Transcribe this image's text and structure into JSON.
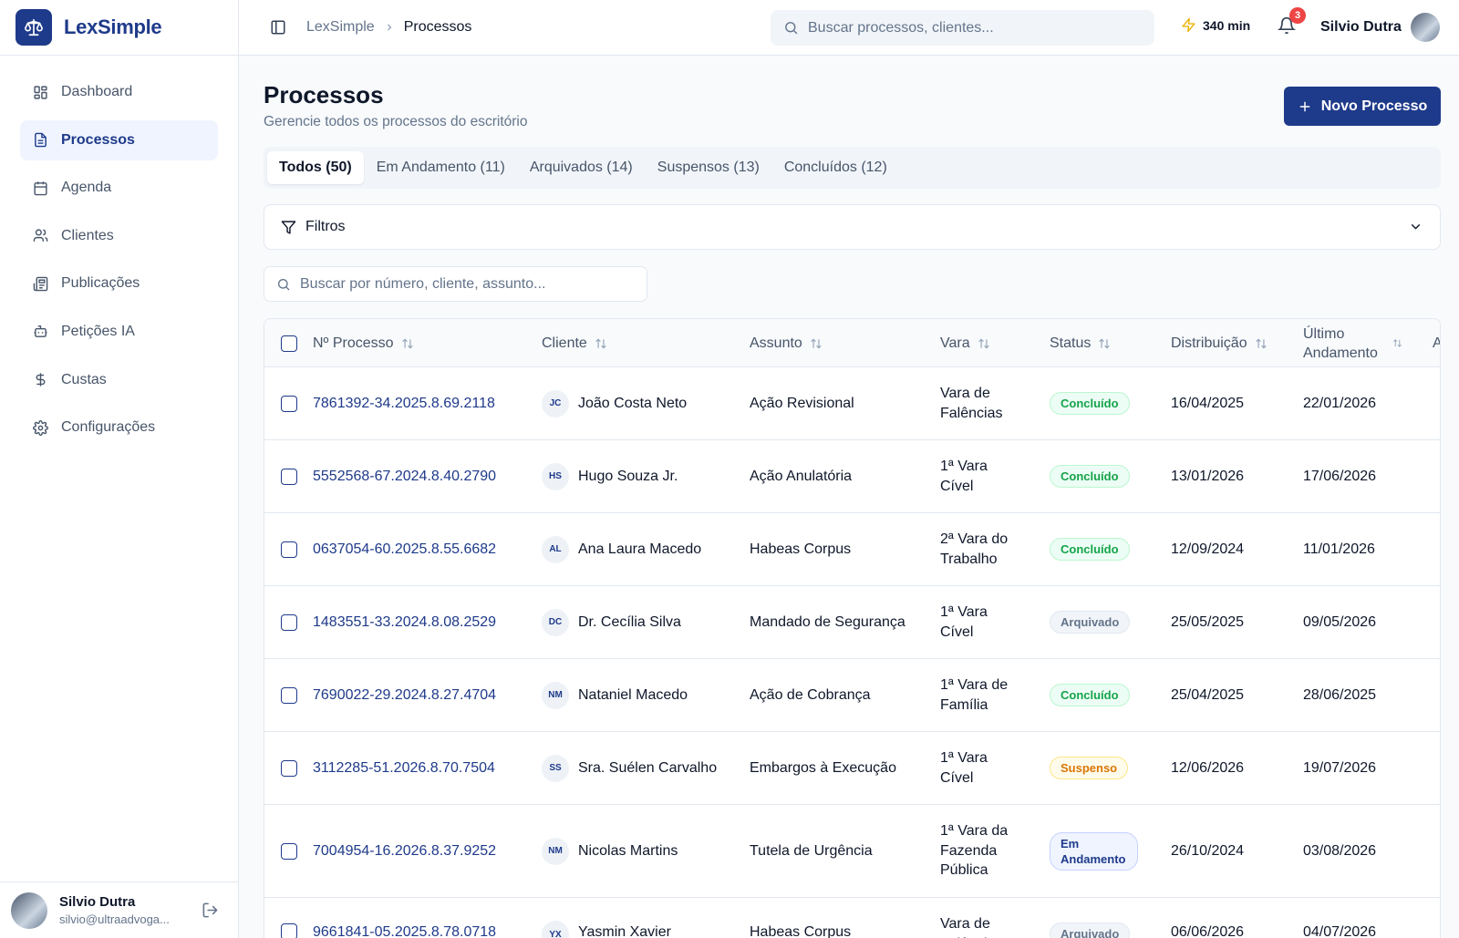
{
  "app": {
    "name": "LexSimple"
  },
  "sidebar": {
    "items": [
      {
        "label": "Dashboard",
        "icon": "dashboard-icon"
      },
      {
        "label": "Processos",
        "icon": "document-icon",
        "active": true
      },
      {
        "label": "Agenda",
        "icon": "calendar-icon"
      },
      {
        "label": "Clientes",
        "icon": "users-icon"
      },
      {
        "label": "Publicações",
        "icon": "newspaper-icon"
      },
      {
        "label": "Petições IA",
        "icon": "robot-icon"
      },
      {
        "label": "Custas",
        "icon": "dollar-icon"
      },
      {
        "label": "Configurações",
        "icon": "gear-icon"
      }
    ],
    "user": {
      "name": "Silvio Dutra",
      "email": "silvio@ultraadvoga..."
    }
  },
  "header": {
    "breadcrumb": [
      "LexSimple",
      "Processos"
    ],
    "search_placeholder": "Buscar processos, clientes...",
    "credits": "340 min",
    "notifications": "3",
    "user_name": "Silvio Dutra"
  },
  "page": {
    "title": "Processos",
    "subtitle": "Gerencie todos os processos do escritório",
    "new_button": "Novo Processo",
    "tabs": [
      "Todos (50)",
      "Em Andamento (11)",
      "Arquivados (14)",
      "Suspensos (13)",
      "Concluídos (12)"
    ],
    "filters_label": "Filtros",
    "table_search_placeholder": "Buscar por número, cliente, assunto..."
  },
  "table": {
    "columns": [
      "Nº Processo",
      "Cliente",
      "Assunto",
      "Vara",
      "Status",
      "Distribuição",
      "Último Andamento",
      "A"
    ],
    "rows": [
      {
        "num": "7861392-34.2025.8.69.2118",
        "ini": "JC",
        "client": "João Costa Neto",
        "subject": "Ação Revisional",
        "vara": "Vara de Falências",
        "status": "Concluído",
        "status_key": "concluido",
        "dist": "16/04/2025",
        "last": "22/01/2026"
      },
      {
        "num": "5552568-67.2024.8.40.2790",
        "ini": "HS",
        "client": "Hugo Souza Jr.",
        "subject": "Ação Anulatória",
        "vara": "1ª Vara Cível",
        "status": "Concluído",
        "status_key": "concluido",
        "dist": "13/01/2026",
        "last": "17/06/2026"
      },
      {
        "num": "0637054-60.2025.8.55.6682",
        "ini": "AL",
        "client": "Ana Laura Macedo",
        "subject": "Habeas Corpus",
        "vara": "2ª Vara do Trabalho",
        "status": "Concluído",
        "status_key": "concluido",
        "dist": "12/09/2024",
        "last": "11/01/2026"
      },
      {
        "num": "1483551-33.2024.8.08.2529",
        "ini": "DC",
        "client": "Dr. Cecília Silva",
        "subject": "Mandado de Segurança",
        "vara": "1ª Vara Cível",
        "status": "Arquivado",
        "status_key": "arquivado",
        "dist": "25/05/2025",
        "last": "09/05/2026"
      },
      {
        "num": "7690022-29.2024.8.27.4704",
        "ini": "NM",
        "client": "Nataniel Macedo",
        "subject": "Ação de Cobrança",
        "vara": "1ª Vara de Família",
        "status": "Concluído",
        "status_key": "concluido",
        "dist": "25/04/2025",
        "last": "28/06/2025"
      },
      {
        "num": "3112285-51.2026.8.70.7504",
        "ini": "SS",
        "client": "Sra. Suélen Carvalho",
        "subject": "Embargos à Execução",
        "vara": "1ª Vara Cível",
        "status": "Suspenso",
        "status_key": "suspenso",
        "dist": "12/06/2026",
        "last": "19/07/2026"
      },
      {
        "num": "7004954-16.2026.8.37.9252",
        "ini": "NM",
        "client": "Nicolas Martins",
        "subject": "Tutela de Urgência",
        "vara": "1ª Vara da Fazenda Pública",
        "status": "Em Andamento",
        "status_key": "andamento",
        "dist": "26/10/2024",
        "last": "03/08/2026"
      },
      {
        "num": "9661841-05.2025.8.78.0718",
        "ini": "YX",
        "client": "Yasmin Xavier",
        "subject": "Habeas Corpus",
        "vara": "Vara de Falências",
        "status": "Arquivado",
        "status_key": "arquivado",
        "dist": "06/06/2026",
        "last": "04/07/2026"
      }
    ]
  },
  "colors": {
    "primary": "#1e3a8a",
    "accent": "#eab308",
    "danger": "#ef4444"
  }
}
